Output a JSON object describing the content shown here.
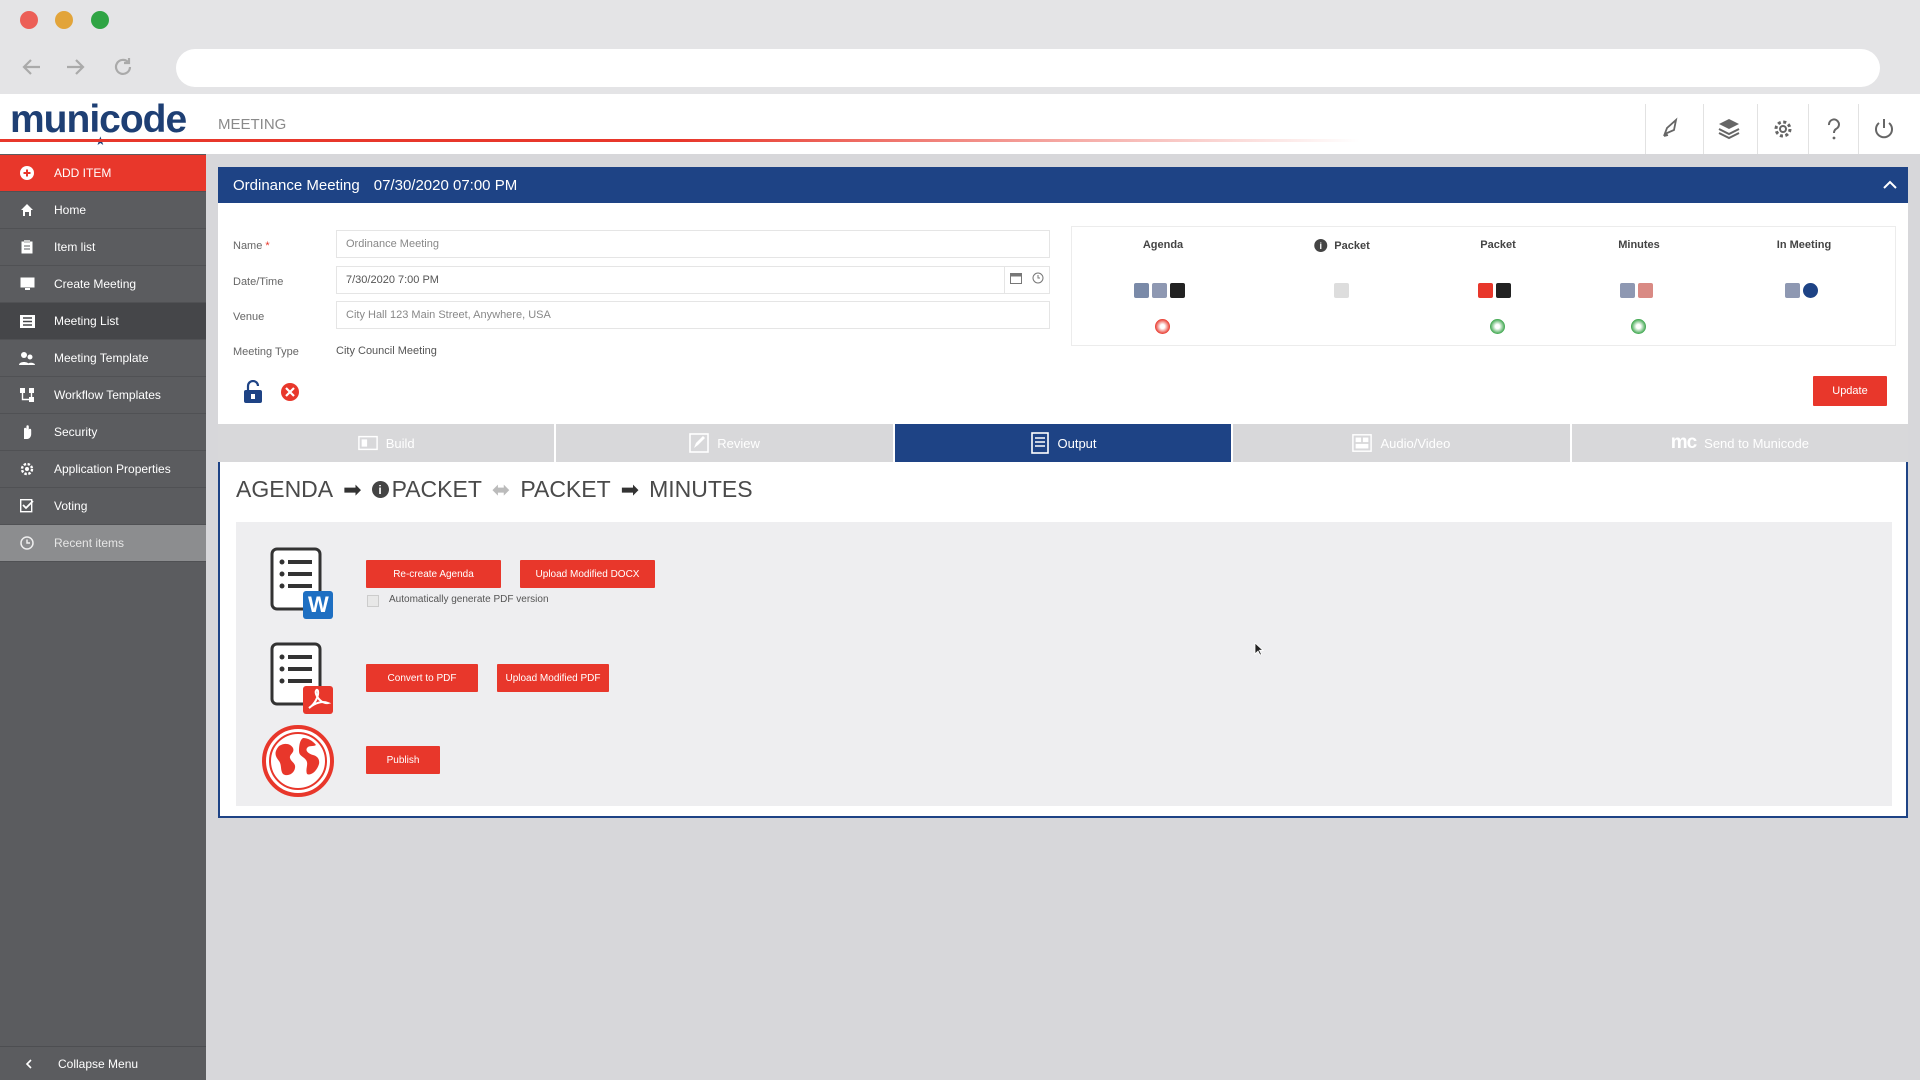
{
  "brand": {
    "logo": "municode",
    "app_label": "MEETING",
    "accent": "#e8372b",
    "navy": "#1e4385"
  },
  "header_icons": [
    "rocket-icon",
    "layers-icon",
    "gear-icon",
    "help-icon",
    "power-icon"
  ],
  "sidebar": {
    "items": [
      {
        "label": "ADD ITEM",
        "icon": "plus-circle-icon"
      },
      {
        "label": "Home",
        "icon": "home-icon"
      },
      {
        "label": "Item list",
        "icon": "clipboard-icon"
      },
      {
        "label": "Create Meeting",
        "icon": "monitor-icon"
      },
      {
        "label": "Meeting List",
        "icon": "list-icon"
      },
      {
        "label": "Meeting Template",
        "icon": "users-icon"
      },
      {
        "label": "Workflow Templates",
        "icon": "workflow-icon"
      },
      {
        "label": "Security",
        "icon": "hand-icon"
      },
      {
        "label": "Application Properties",
        "icon": "cog-icon"
      },
      {
        "label": "Voting",
        "icon": "checkbox-icon"
      },
      {
        "label": "Recent items",
        "icon": "clock-icon"
      }
    ],
    "collapse_label": "Collapse Menu"
  },
  "meeting": {
    "title": "Ordinance Meeting",
    "datetime": "07/30/2020 07:00 PM",
    "fields": {
      "name_label": "Name",
      "name_required": "*",
      "name_value": "Ordinance Meeting",
      "datetime_label": "Date/Time",
      "datetime_value": "7/30/2020 7:00 PM",
      "venue_label": "Venue",
      "venue_value": "City Hall 123 Main Street, Anywhere, USA",
      "type_label": "Meeting Type",
      "type_value": "City Council Meeting"
    },
    "status_columns": [
      "Agenda",
      "Packet",
      "Packet",
      "Minutes",
      "In Meeting"
    ],
    "update_label": "Update"
  },
  "tabs": [
    {
      "label": "Build",
      "icon": "build-icon"
    },
    {
      "label": "Review",
      "icon": "pencil-icon"
    },
    {
      "label": "Output",
      "icon": "document-icon",
      "active": true
    },
    {
      "label": "Audio/Video",
      "icon": "film-icon"
    },
    {
      "label": "Send to Municode",
      "icon": "mc-icon",
      "prefix": "MC"
    }
  ],
  "workflow": {
    "steps": [
      "AGENDA",
      "PACKET",
      "PACKET",
      "MINUTES"
    ],
    "info_glyph": "i"
  },
  "output": {
    "word_doc_label": "W",
    "recreate_agenda": "Re-create Agenda",
    "upload_docx": "Upload Modified DOCX",
    "auto_pdf_label": "Automatically generate PDF version",
    "convert_pdf": "Convert to PDF",
    "upload_pdf": "Upload Modified PDF",
    "publish": "Publish"
  }
}
